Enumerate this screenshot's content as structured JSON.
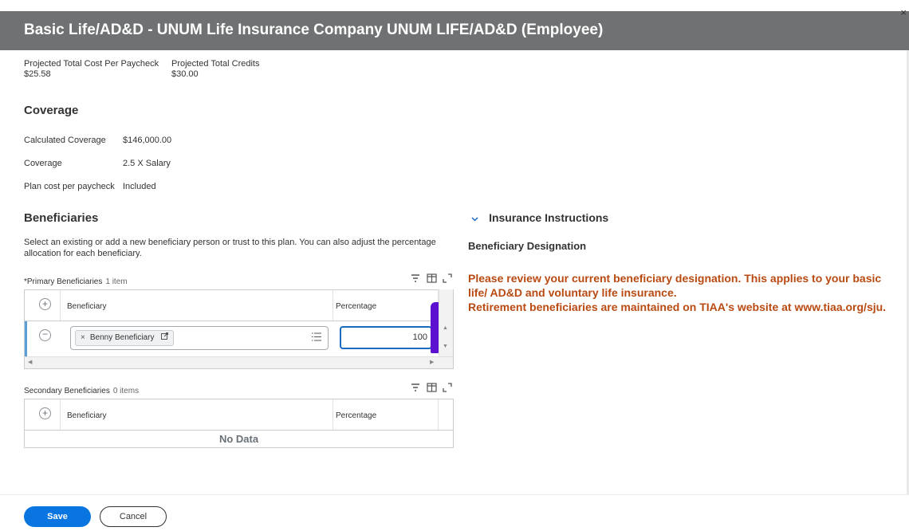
{
  "title": "Basic Life/AD&D - UNUM Life Insurance Company UNUM LIFE/AD&D (Employee)",
  "close_glyph": "×",
  "projected": [
    {
      "label": "Projected Total Cost Per Paycheck",
      "value": "$25.58"
    },
    {
      "label": "Projected Total Credits",
      "value": "$30.00"
    }
  ],
  "coverage": {
    "heading": "Coverage",
    "rows": [
      {
        "label": "Calculated Coverage",
        "value": "$146,000.00"
      },
      {
        "label": "Coverage",
        "value": "2.5 X Salary"
      },
      {
        "label": "Plan cost per paycheck",
        "value": "Included"
      }
    ]
  },
  "beneficiaries": {
    "heading": "Beneficiaries",
    "description": "Select an existing or add a new beneficiary person or trust to this plan. You can also adjust the percentage allocation for each beneficiary.",
    "primary": {
      "label": "*Primary Beneficiaries",
      "count": "1 item",
      "columns": [
        "Beneficiary",
        "Percentage"
      ],
      "rows": [
        {
          "beneficiary": "Benny Beneficiary",
          "percentage": "100"
        }
      ]
    },
    "secondary": {
      "label": "Secondary Beneficiaries",
      "count": "0 items",
      "columns": [
        "Beneficiary",
        "Percentage"
      ],
      "empty_text": "No Data"
    }
  },
  "instructions": {
    "heading": "Insurance Instructions",
    "subheading": "Beneficiary Designation",
    "line1": "Please review your current beneficiary designation. This applies to your basic life/ AD&D and voluntary life insurance.",
    "line2": "Retirement beneficiaries are maintained on TIAA's website at www.tiaa.org/sju.",
    "text_color": "#b94a12"
  },
  "icons": {
    "filter": "filter-icon",
    "columns": "columns-icon",
    "expand": "expand-icon",
    "add": "plus-circle-icon",
    "remove": "minus-circle-icon",
    "list": "list-icon",
    "external": "external-link-icon",
    "chevron": "chevron-down-icon"
  },
  "actions": {
    "save": "Save",
    "cancel": "Cancel"
  },
  "colors": {
    "title_bar": "#6f7172",
    "primary_button": "#0875e1",
    "focus_border": "#1a6bbf",
    "highlight_mark": "#5b11cf"
  }
}
